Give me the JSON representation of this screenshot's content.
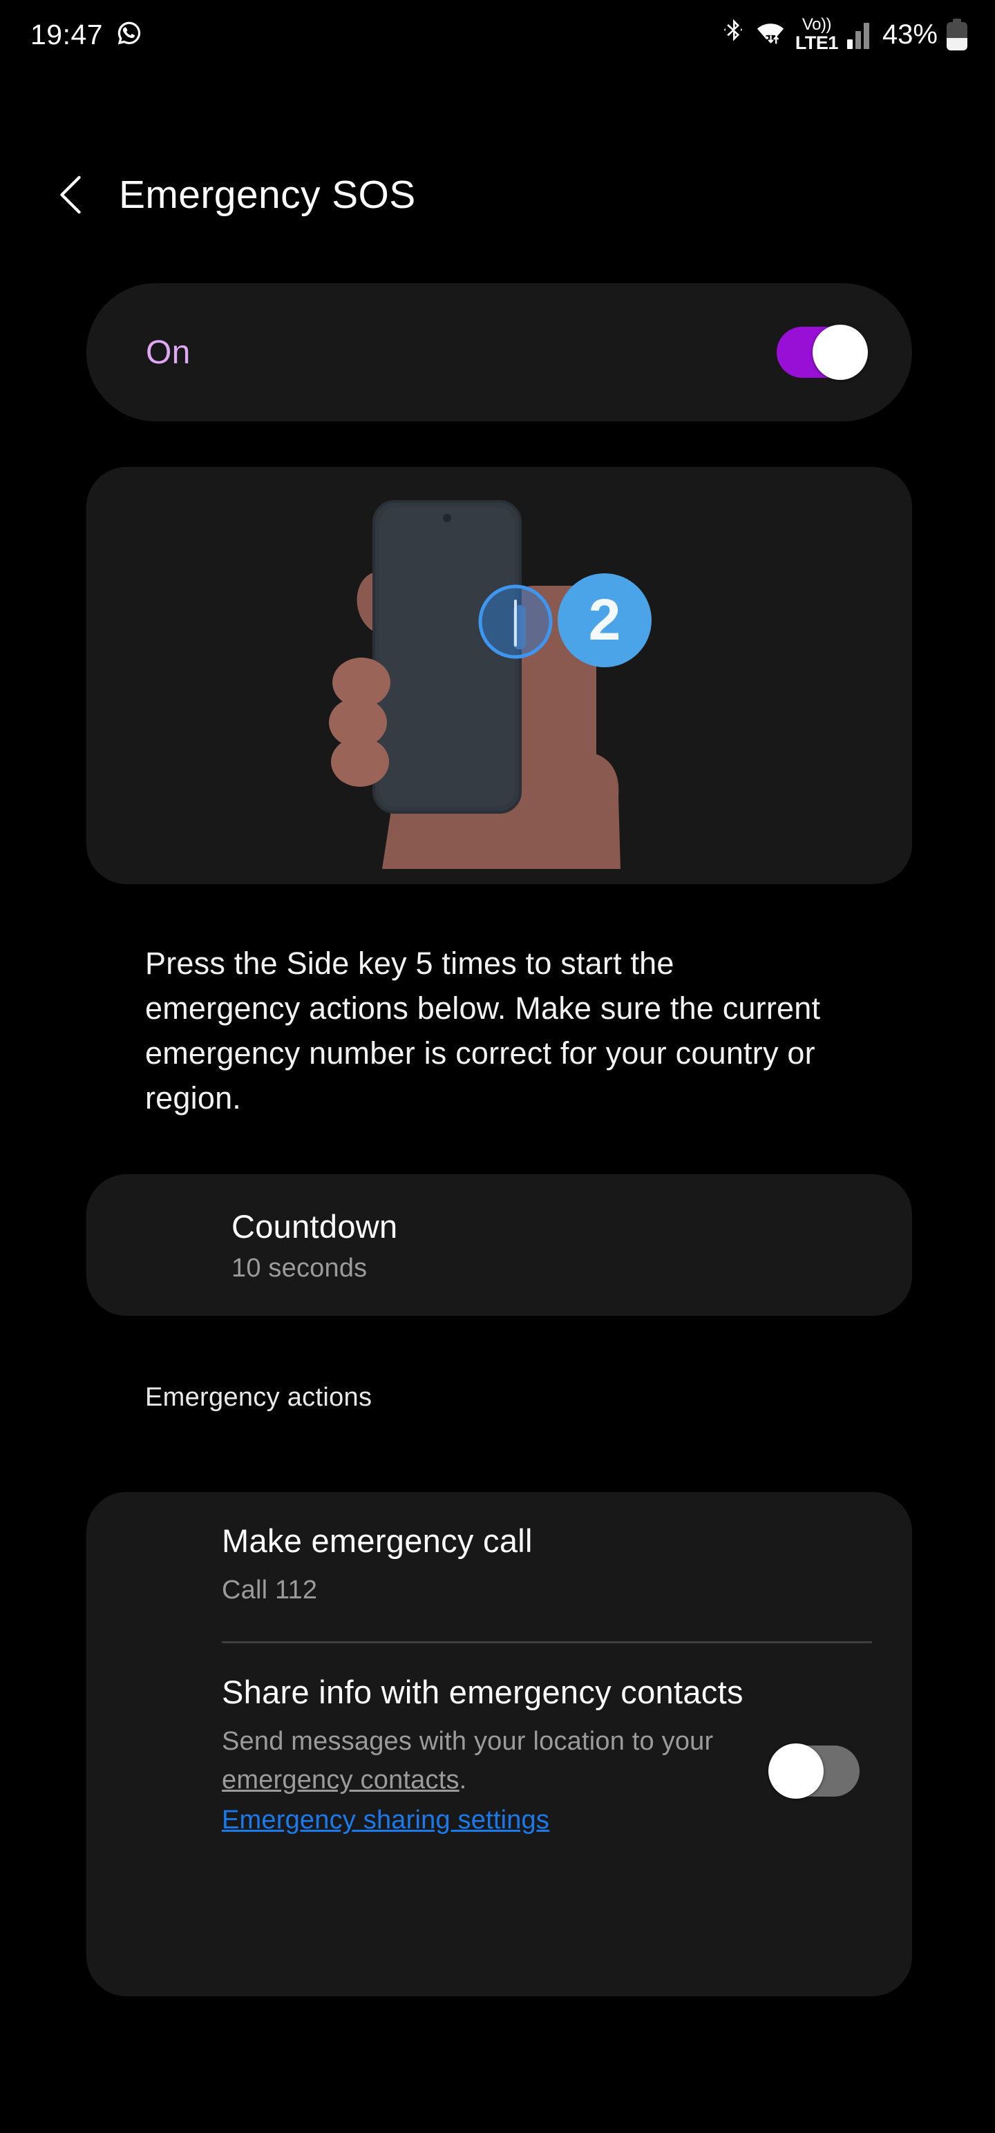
{
  "status_bar": {
    "time": "19:47",
    "icons_left": [
      "whatsapp-icon"
    ],
    "icons_right": [
      "bluetooth-icon",
      "wifi-icon",
      "volte-icon",
      "signal-icon",
      "battery-icon"
    ],
    "network_label_top": "Vo))",
    "network_label_bottom": "LTE1",
    "battery_percent": "43%"
  },
  "header": {
    "back_icon": "chevron-left-icon",
    "title": "Emergency SOS"
  },
  "master_toggle": {
    "label": "On",
    "state": "on",
    "accent_color": "#9810d6",
    "label_color": "#dfa8f4"
  },
  "illustration": {
    "name": "hand-holding-phone-side-key",
    "badge_number": "2",
    "badge_color": "#4ba3e8",
    "phone_body_color": "#31383f",
    "hand_color": "#8a5a50",
    "highlight_color": "#2f7fd6"
  },
  "description": "Press the Side key 5 times to start the emergency actions below. Make sure the current emergency number is correct for your country or region.",
  "countdown": {
    "title": "Countdown",
    "value": "10 seconds"
  },
  "section_header": "Emergency actions",
  "actions": {
    "call": {
      "title": "Make emergency call",
      "subtitle": "Call 112"
    },
    "share": {
      "title": "Share info with emergency contacts",
      "subtitle_part1": "Send messages with your location to your ",
      "subtitle_link": "emergency contacts",
      "subtitle_part2": ".",
      "settings_link": "Emergency sharing settings",
      "link_color": "#1a7aeb",
      "state": "off"
    }
  }
}
